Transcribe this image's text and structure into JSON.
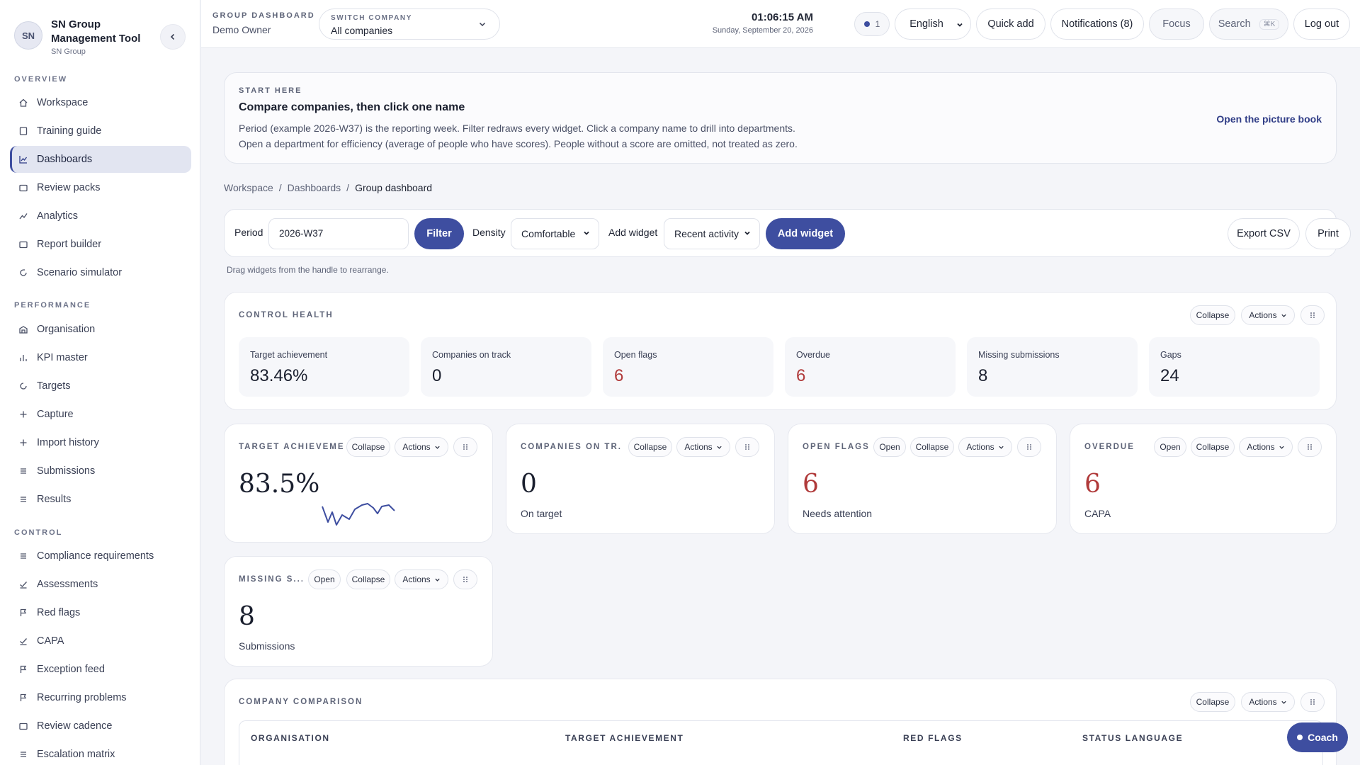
{
  "sidebar": {
    "avatar": "SN",
    "title": "SN Group Management Tool",
    "subtitle": "SN Group",
    "sections": {
      "overview": "OVERVIEW",
      "performance": "PERFORMANCE",
      "control": "CONTROL"
    },
    "items": {
      "workspace": "Workspace",
      "training": "Training guide",
      "dashboards": "Dashboards",
      "review_packs": "Review packs",
      "analytics": "Analytics",
      "report_builder": "Report builder",
      "scenario": "Scenario simulator",
      "organisation": "Organisation",
      "kpi_master": "KPI master",
      "targets": "Targets",
      "capture": "Capture",
      "import_history": "Import history",
      "submissions": "Submissions",
      "results": "Results",
      "compliance": "Compliance requirements",
      "assessments": "Assessments",
      "red_flags": "Red flags",
      "capa": "CAPA",
      "exception_feed": "Exception feed",
      "recurring": "Recurring problems",
      "review_cadence": "Review cadence",
      "escalation": "Escalation matrix"
    }
  },
  "header": {
    "kicker": "GROUP DASHBOARD",
    "owner": "Demo Owner",
    "switch_label": "SWITCH COMPANY",
    "switch_value": "All companies",
    "time": "01:06:15 AM",
    "date": "Sunday, September 20, 2026",
    "indicator_count": "1",
    "language": "English",
    "quick_add": "Quick add",
    "notifications": "Notifications (8)",
    "focus": "Focus",
    "search": "Search",
    "search_shortcut": "⌘K",
    "logout": "Log out"
  },
  "start_here": {
    "kicker": "START HERE",
    "heading": "Compare companies, then click one name",
    "line1": "Period (example 2026-W37) is the reporting week. Filter redraws every widget. Click a company name to drill into departments.",
    "line2": "Open a department for efficiency (average of people who have scores). People without a score are omitted, not treated as zero.",
    "link": "Open the picture book"
  },
  "breadcrumb": {
    "a": "Workspace",
    "b": "Dashboards",
    "c": "Group dashboard",
    "sep": "/"
  },
  "filters": {
    "period_label": "Period",
    "period_value": "2026-W37",
    "filter_btn": "Filter",
    "density_label": "Density",
    "density_value": "Comfortable",
    "add_widget_label": "Add widget",
    "widget_value": "Recent activity",
    "add_widget_btn": "Add widget",
    "export": "Export CSV",
    "print": "Print",
    "hint": "Drag widgets from the handle to rearrange."
  },
  "common": {
    "collapse": "Collapse",
    "actions": "Actions",
    "open": "Open"
  },
  "control_health": {
    "title": "CONTROL HEALTH",
    "stats": [
      {
        "label": "Target achievement",
        "value": "83.46%"
      },
      {
        "label": "Companies on track",
        "value": "0"
      },
      {
        "label": "Open flags",
        "value": "6"
      },
      {
        "label": "Overdue",
        "value": "6"
      },
      {
        "label": "Missing submissions",
        "value": "8"
      },
      {
        "label": "Gaps",
        "value": "24"
      }
    ]
  },
  "widgets": {
    "target": {
      "title": "TARGET ACHIEVEME...",
      "value": "83.5%"
    },
    "companies": {
      "title": "COMPANIES ON TR...",
      "value": "0",
      "sub": "On target"
    },
    "open_flags": {
      "title": "OPEN FLAGS",
      "value": "6",
      "sub": "Needs attention"
    },
    "overdue": {
      "title": "OVERDUE",
      "value": "6",
      "sub": "CAPA"
    },
    "missing": {
      "title": "MISSING S...",
      "value": "8",
      "sub": "Submissions"
    }
  },
  "comparison": {
    "title": "COMPANY COMPARISON",
    "columns": [
      "ORGANISATION",
      "TARGET ACHIEVEMENT",
      "RED FLAGS",
      "STATUS LANGUAGE"
    ]
  },
  "coach": "Coach",
  "colors": {
    "accent": "#3e4ea0",
    "danger": "#b03a3a"
  }
}
